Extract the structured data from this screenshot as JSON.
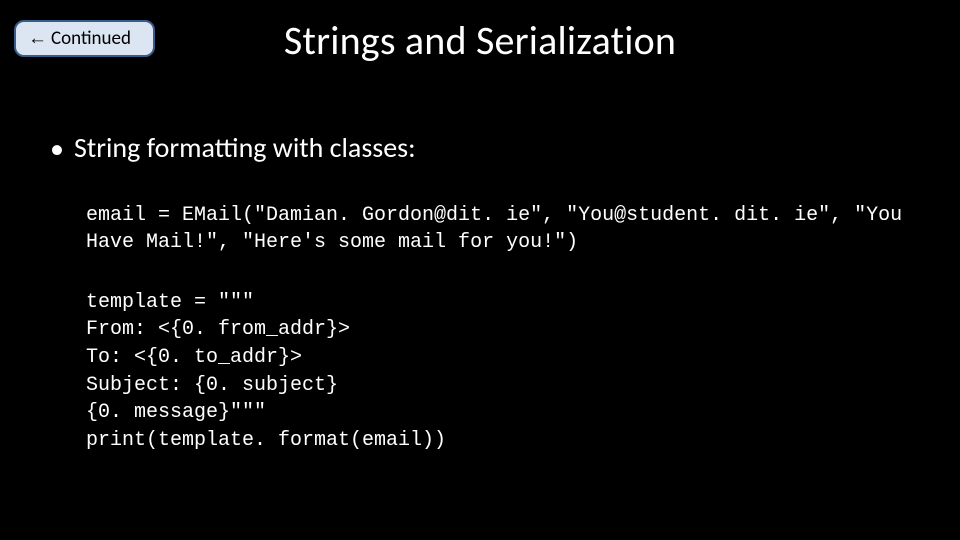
{
  "badge": {
    "arrow": "←",
    "label": "Continued"
  },
  "title": "Strings and Serialization",
  "bullet": "String formatting with classes:",
  "code_block1": "email = EMail(\"Damian. Gordon@dit. ie\", \"You@student. dit. ie\", \"You Have Mail!\", \"Here's some mail for you!\")",
  "code_block2": "template = \"\"\"\nFrom: <{0. from_addr}>\nTo: <{0. to_addr}>\nSubject: {0. subject}\n{0. message}\"\"\"\nprint(template. format(email))"
}
